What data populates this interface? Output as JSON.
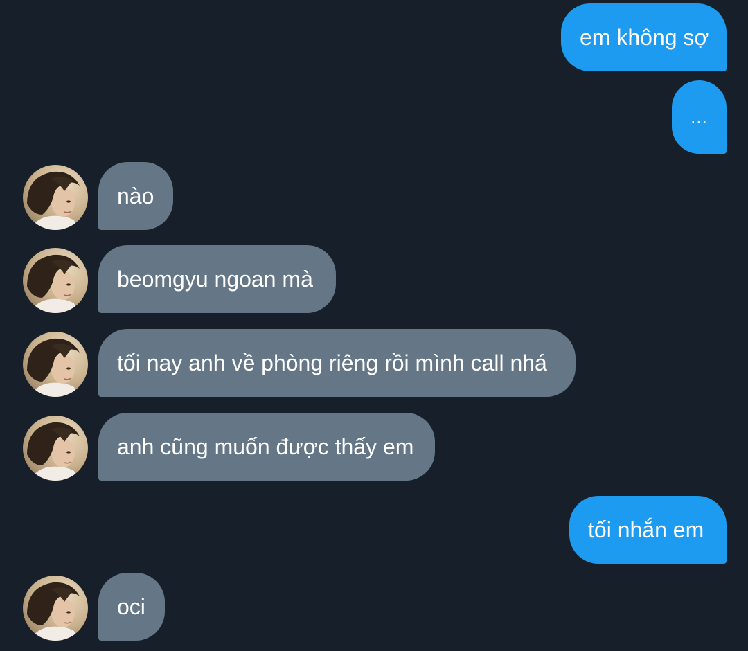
{
  "conversation": {
    "messages": [
      {
        "sender": "me",
        "text": "em không sợ"
      },
      {
        "sender": "me",
        "text": "..."
      },
      {
        "sender": "contact",
        "text": "nào"
      },
      {
        "sender": "contact",
        "text": "beomgyu ngoan mà"
      },
      {
        "sender": "contact",
        "text": "tối nay anh về phòng riêng rồi mình call nhá"
      },
      {
        "sender": "contact",
        "text": "anh cũng muốn được thấy em"
      },
      {
        "sender": "me",
        "text": "tối nhắn em"
      },
      {
        "sender": "contact",
        "text": "oci"
      }
    ]
  },
  "colors": {
    "background": "#17202a",
    "sent_bubble": "#1d9bf0",
    "received_bubble": "#657786",
    "text": "#ffffff"
  },
  "icons": {
    "avatar": "contact-avatar-photo"
  }
}
